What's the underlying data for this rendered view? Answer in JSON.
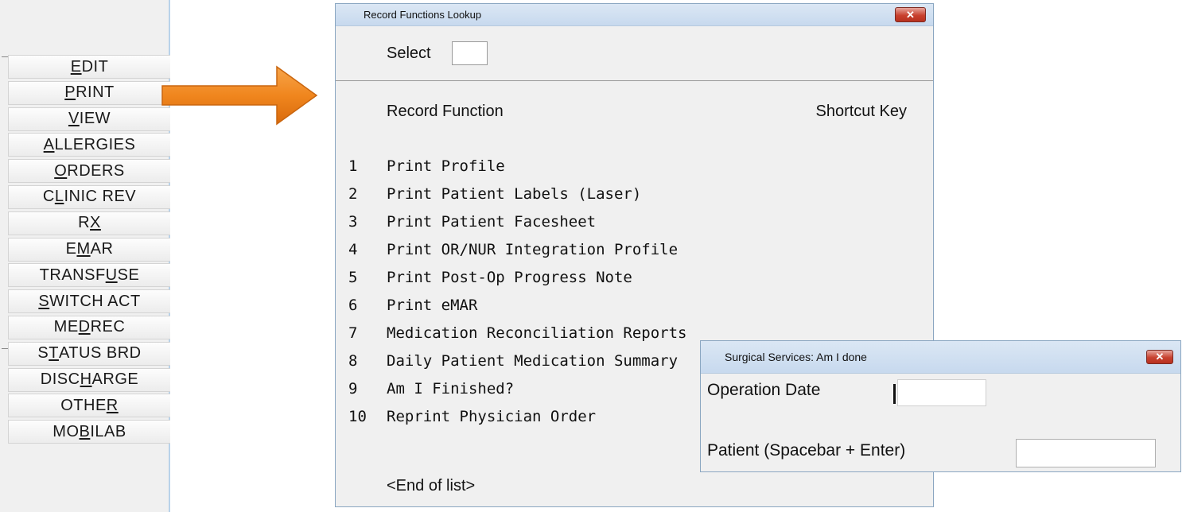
{
  "left_panel": {
    "buttons": [
      {
        "pre": "",
        "key": "E",
        "post": "DIT"
      },
      {
        "pre": "",
        "key": "P",
        "post": "RINT"
      },
      {
        "pre": "",
        "key": "V",
        "post": "IEW"
      },
      {
        "pre": "",
        "key": "A",
        "post": "LLERGIES"
      },
      {
        "pre": "",
        "key": "O",
        "post": "RDERS"
      },
      {
        "pre": "C",
        "key": "L",
        "post": "INIC REV"
      },
      {
        "pre": "R",
        "key": "X",
        "post": ""
      },
      {
        "pre": "E",
        "key": "M",
        "post": "AR"
      },
      {
        "pre": "TRANSF",
        "key": "U",
        "post": "SE"
      },
      {
        "pre": "",
        "key": "S",
        "post": "WITCH ACT"
      },
      {
        "pre": "ME",
        "key": "D",
        "post": " REC"
      },
      {
        "pre": "S",
        "key": "T",
        "post": "ATUS BRD"
      },
      {
        "pre": "DISC",
        "key": "H",
        "post": "ARGE"
      },
      {
        "pre": "OTHE",
        "key": "R",
        "post": ""
      },
      {
        "pre": "MO",
        "key": "B",
        "post": "ILAB"
      }
    ]
  },
  "lookup_dialog": {
    "title": "Record Functions Lookup",
    "close": "✕",
    "select_label": "Select",
    "select_value": "",
    "header_function": "Record Function",
    "header_shortcut": "Shortcut Key",
    "items": [
      {
        "num": "1",
        "label": "Print Profile"
      },
      {
        "num": "2",
        "label": "Print Patient Labels (Laser)"
      },
      {
        "num": "3",
        "label": "Print Patient Facesheet"
      },
      {
        "num": "4",
        "label": "Print OR/NUR Integration Profile"
      },
      {
        "num": "5",
        "label": "Print Post-Op Progress Note"
      },
      {
        "num": "6",
        "label": "Print eMAR"
      },
      {
        "num": "7",
        "label": "Medication Reconciliation Reports"
      },
      {
        "num": "8",
        "label": "Daily Patient Medication Summary"
      },
      {
        "num": "9",
        "label": "Am I Finished?"
      },
      {
        "num": "10",
        "label": "Reprint Physician Order"
      }
    ],
    "end_label": "<End of list>"
  },
  "surgical_dialog": {
    "title": "Surgical Services: Am I done",
    "close": "✕",
    "operation_date_label": "Operation Date",
    "operation_date_value": "",
    "patient_label": "Patient (Spacebar + Enter)",
    "patient_value": ""
  },
  "colors": {
    "arrow": "#f0861e",
    "close_button": "#c8412f",
    "titlebar": "#c7d9ee"
  }
}
